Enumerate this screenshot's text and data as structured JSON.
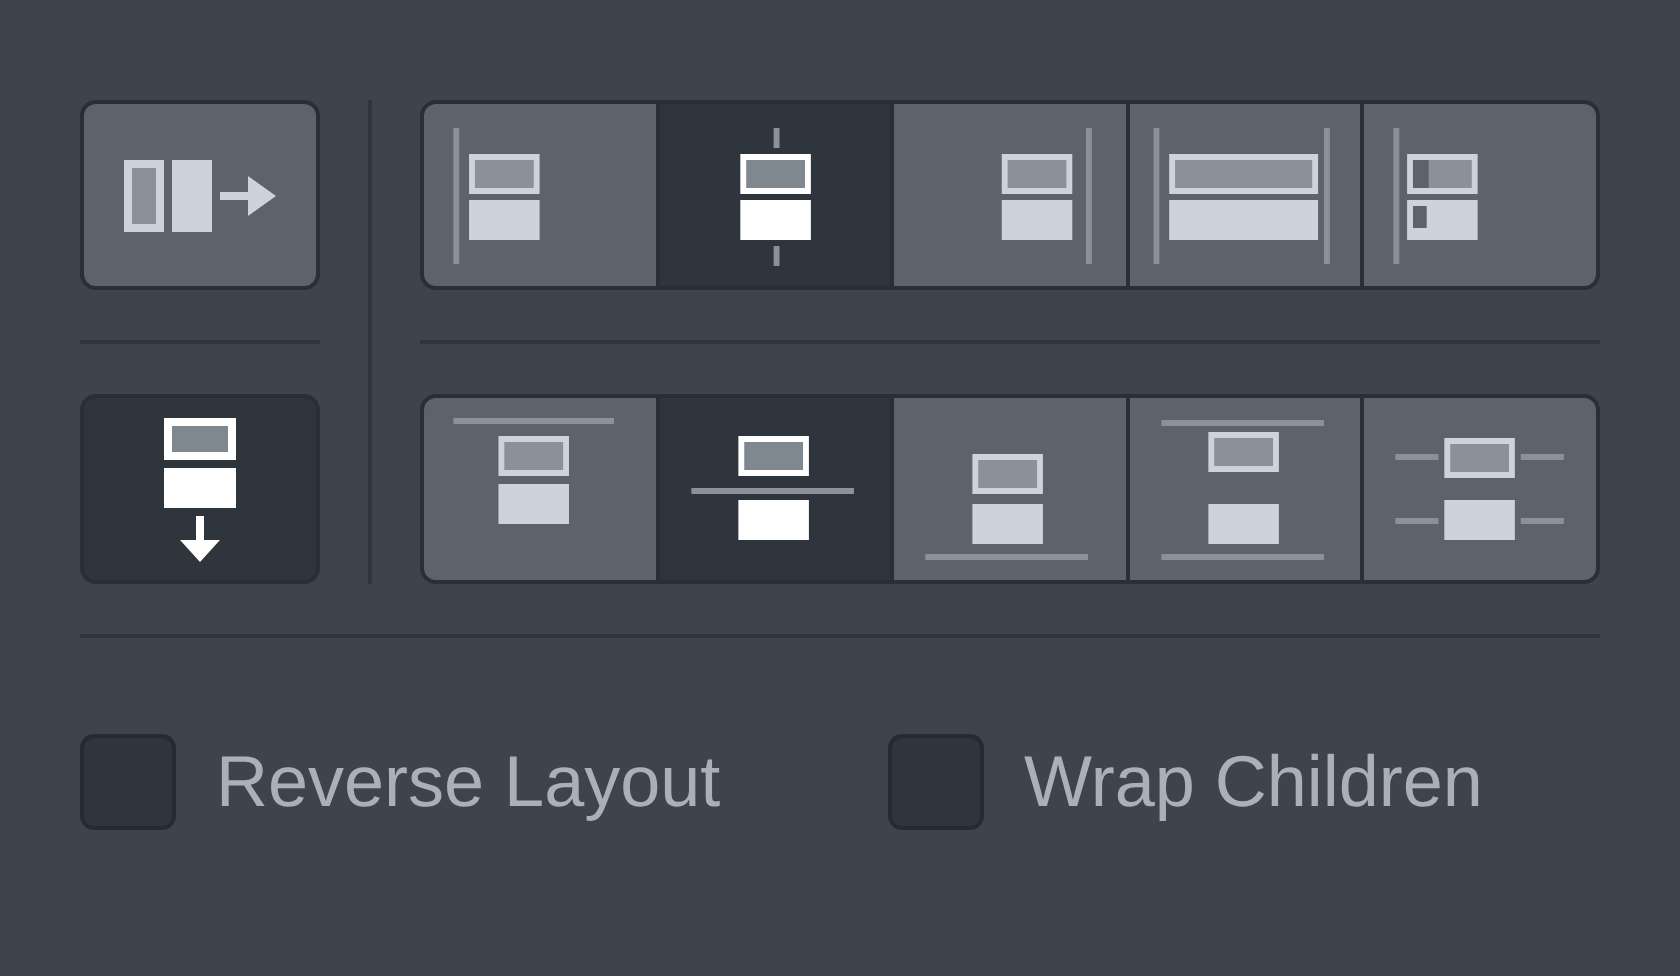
{
  "direction_buttons": [
    {
      "kind": "horizontal",
      "selected": false
    },
    {
      "kind": "vertical",
      "selected": true
    }
  ],
  "alignment_rows": [
    {
      "items": [
        {
          "kind": "h_start",
          "selected": false
        },
        {
          "kind": "h_center",
          "selected": true
        },
        {
          "kind": "h_end",
          "selected": false
        },
        {
          "kind": "h_stretch",
          "selected": false
        },
        {
          "kind": "h_baseline",
          "selected": false
        }
      ]
    },
    {
      "items": [
        {
          "kind": "v_start",
          "selected": false
        },
        {
          "kind": "v_center",
          "selected": true
        },
        {
          "kind": "v_end",
          "selected": false
        },
        {
          "kind": "v_space_between",
          "selected": false
        },
        {
          "kind": "v_baseline",
          "selected": false
        }
      ]
    }
  ],
  "checkboxes": [
    {
      "label": "Reverse Layout",
      "checked": false
    },
    {
      "label": "Wrap Children",
      "checked": false
    }
  ]
}
